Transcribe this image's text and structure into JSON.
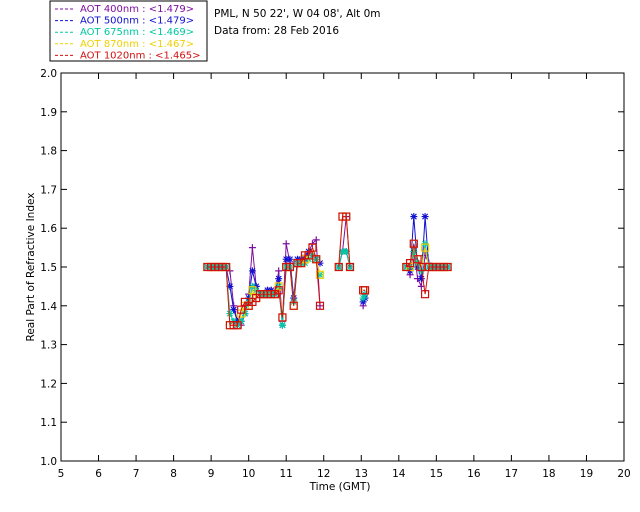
{
  "legend": {
    "entries": [
      {
        "label": "AOT  400nm : <1.479>",
        "color": "#7f0f9f"
      },
      {
        "label": "AOT  500nm : <1.479>",
        "color": "#1010d0"
      },
      {
        "label": "AOT  675nm : <1.469>",
        "color": "#00c8a0"
      },
      {
        "label": "AOT  870nm : <1.467>",
        "color": "#f0d000"
      },
      {
        "label": "AOT 1020nm : <1.465>",
        "color": "#d01010"
      }
    ]
  },
  "info": {
    "line1": "PML, N 50 22', W 04 08', Alt 0m",
    "line2": "Data from: 28 Feb 2016"
  },
  "chart_data": {
    "type": "line",
    "xlabel": "Time (GMT)",
    "ylabel": "Real Part of Refractive Index",
    "xlim": [
      5,
      20
    ],
    "ylim": [
      1.0,
      2.0
    ],
    "xticks": [
      5,
      6,
      7,
      8,
      9,
      10,
      11,
      12,
      13,
      14,
      15,
      16,
      17,
      18,
      19,
      20
    ],
    "yticks": [
      1.0,
      1.1,
      1.2,
      1.3,
      1.4,
      1.5,
      1.6,
      1.7,
      1.8,
      1.9,
      2.0
    ],
    "grid": false,
    "series": [
      {
        "name": "AOT  400nm : <1.479>",
        "color": "#7f0f9f",
        "marker": "plus",
        "x": [
          8.9,
          9.0,
          9.1,
          9.2,
          9.3,
          9.4,
          9.5,
          9.6,
          9.7,
          9.8,
          9.9,
          10.0,
          10.1,
          10.2,
          10.3,
          10.4,
          10.5,
          10.6,
          10.7,
          10.8,
          10.9,
          11.0,
          11.1,
          11.2,
          11.3,
          11.4,
          11.5,
          11.6,
          11.7,
          11.8,
          11.9,
          null,
          12.4,
          12.5,
          12.6,
          12.7,
          null,
          13.05,
          13.1,
          null,
          14.2,
          14.3,
          14.4,
          14.5,
          14.6,
          14.7,
          14.8,
          14.9,
          15.0,
          15.1,
          15.2,
          15.3
        ],
        "y": [
          1.5,
          1.5,
          1.5,
          1.5,
          1.5,
          1.5,
          1.49,
          1.4,
          1.36,
          1.35,
          1.38,
          1.43,
          1.55,
          1.45,
          1.43,
          1.43,
          1.44,
          1.44,
          1.43,
          1.49,
          1.36,
          1.56,
          1.51,
          1.41,
          1.51,
          1.51,
          1.53,
          1.54,
          1.56,
          1.57,
          1.4,
          null,
          1.5,
          1.54,
          1.63,
          1.5,
          null,
          1.4,
          1.43,
          null,
          1.5,
          1.48,
          1.55,
          1.47,
          1.45,
          1.53,
          1.51,
          1.5,
          1.5,
          1.5,
          1.5,
          1.5
        ]
      },
      {
        "name": "AOT  500nm : <1.479>",
        "color": "#1010d0",
        "marker": "star",
        "x": [
          8.9,
          9.0,
          9.1,
          9.2,
          9.3,
          9.4,
          9.5,
          9.6,
          9.7,
          9.8,
          9.9,
          10.0,
          10.1,
          10.2,
          10.3,
          10.4,
          10.5,
          10.6,
          10.7,
          10.8,
          10.9,
          11.0,
          11.1,
          11.2,
          11.3,
          11.4,
          11.5,
          11.6,
          11.7,
          11.8,
          11.9,
          null,
          12.4,
          12.5,
          12.6,
          12.7,
          null,
          13.05,
          13.1,
          null,
          14.2,
          14.3,
          14.4,
          14.5,
          14.6,
          14.7,
          14.8,
          14.9,
          15.0,
          15.1,
          15.2,
          15.3
        ],
        "y": [
          1.5,
          1.5,
          1.5,
          1.5,
          1.5,
          1.5,
          1.45,
          1.39,
          1.36,
          1.36,
          1.38,
          1.42,
          1.49,
          1.45,
          1.43,
          1.43,
          1.44,
          1.44,
          1.43,
          1.47,
          1.35,
          1.52,
          1.52,
          1.42,
          1.52,
          1.52,
          1.52,
          1.54,
          1.53,
          1.52,
          1.51,
          null,
          1.5,
          1.54,
          1.54,
          1.5,
          null,
          1.41,
          1.42,
          null,
          1.5,
          1.49,
          1.63,
          1.5,
          1.47,
          1.63,
          1.5,
          1.5,
          1.5,
          1.5,
          1.5,
          1.5
        ]
      },
      {
        "name": "AOT  675nm : <1.469>",
        "color": "#00c8a0",
        "marker": "star",
        "x": [
          8.9,
          9.0,
          9.1,
          9.2,
          9.3,
          9.4,
          9.5,
          9.6,
          9.7,
          9.8,
          9.9,
          10.0,
          10.1,
          10.2,
          10.3,
          10.4,
          10.5,
          10.6,
          10.7,
          10.8,
          10.9,
          11.0,
          11.1,
          11.2,
          11.3,
          11.4,
          11.5,
          11.6,
          11.7,
          11.8,
          11.9,
          null,
          12.4,
          12.5,
          12.6,
          12.7,
          null,
          13.05,
          13.1,
          null,
          14.2,
          14.3,
          14.4,
          14.5,
          14.6,
          14.7,
          14.8,
          14.9,
          15.0,
          15.1,
          15.2,
          15.3
        ],
        "y": [
          1.5,
          1.5,
          1.5,
          1.5,
          1.5,
          1.5,
          1.38,
          1.36,
          1.35,
          1.36,
          1.38,
          1.41,
          1.45,
          1.44,
          1.43,
          1.43,
          1.43,
          1.43,
          1.43,
          1.45,
          1.35,
          1.5,
          1.5,
          1.41,
          1.51,
          1.51,
          1.51,
          1.52,
          1.53,
          1.52,
          1.48,
          null,
          1.5,
          1.54,
          1.54,
          1.5,
          null,
          1.42,
          1.43,
          null,
          1.5,
          1.5,
          1.54,
          1.51,
          1.49,
          1.56,
          1.5,
          1.5,
          1.5,
          1.5,
          1.5,
          1.5
        ]
      },
      {
        "name": "AOT  870nm : <1.467>",
        "color": "#f0d000",
        "marker": "square",
        "x": [
          8.9,
          9.0,
          9.1,
          9.2,
          9.3,
          9.4,
          9.5,
          9.6,
          9.7,
          9.8,
          9.9,
          10.0,
          10.1,
          10.2,
          10.3,
          10.4,
          10.5,
          10.6,
          10.7,
          10.8,
          10.9,
          11.0,
          11.1,
          11.2,
          11.3,
          11.4,
          11.5,
          11.6,
          11.7,
          11.8,
          11.9,
          null,
          12.4,
          12.5,
          12.6,
          12.7,
          null,
          13.05,
          13.1,
          null,
          14.2,
          14.3,
          14.4,
          14.5,
          14.6,
          14.7,
          14.8,
          14.9,
          15.0,
          15.1,
          15.2,
          15.3
        ],
        "y": [
          1.5,
          1.5,
          1.5,
          1.5,
          1.5,
          1.5,
          1.35,
          1.35,
          1.35,
          1.38,
          1.4,
          1.4,
          1.44,
          1.42,
          1.43,
          1.43,
          1.43,
          1.43,
          1.43,
          1.45,
          1.37,
          1.5,
          1.5,
          1.4,
          1.51,
          1.51,
          1.52,
          1.53,
          1.55,
          1.52,
          1.48,
          null,
          1.5,
          1.63,
          1.63,
          1.5,
          null,
          1.44,
          1.44,
          null,
          1.5,
          1.5,
          1.56,
          1.52,
          1.5,
          1.55,
          1.5,
          1.5,
          1.5,
          1.5,
          1.5,
          1.5
        ]
      },
      {
        "name": "AOT 1020nm : <1.465>",
        "color": "#d01010",
        "marker": "square",
        "x": [
          8.9,
          9.0,
          9.1,
          9.2,
          9.3,
          9.4,
          9.5,
          9.6,
          9.7,
          9.8,
          9.9,
          10.0,
          10.1,
          10.2,
          10.3,
          10.4,
          10.5,
          10.6,
          10.7,
          10.8,
          10.9,
          11.0,
          11.1,
          11.2,
          11.3,
          11.4,
          11.5,
          11.6,
          11.7,
          11.8,
          11.9,
          null,
          12.4,
          12.5,
          12.6,
          12.7,
          null,
          13.05,
          13.1,
          null,
          14.2,
          14.3,
          14.4,
          14.5,
          14.6,
          14.7,
          14.8,
          14.9,
          15.0,
          15.1,
          15.2,
          15.3
        ],
        "y": [
          1.5,
          1.5,
          1.5,
          1.5,
          1.5,
          1.5,
          1.35,
          1.35,
          1.35,
          1.39,
          1.41,
          1.4,
          1.41,
          1.42,
          1.43,
          1.43,
          1.43,
          1.43,
          1.43,
          1.44,
          1.37,
          1.5,
          1.5,
          1.4,
          1.51,
          1.51,
          1.53,
          1.53,
          1.55,
          1.52,
          1.4,
          null,
          1.5,
          1.63,
          1.63,
          1.5,
          null,
          1.44,
          1.44,
          null,
          1.5,
          1.51,
          1.56,
          1.52,
          1.5,
          1.43,
          1.5,
          1.5,
          1.5,
          1.5,
          1.5,
          1.5
        ]
      }
    ]
  }
}
